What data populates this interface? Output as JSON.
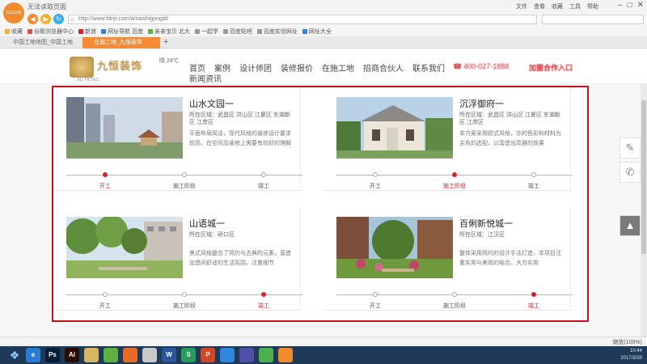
{
  "browser": {
    "logo_text": "ozzoos",
    "title": "无法读取页面",
    "title_menus": [
      "文件",
      "查看",
      "收藏",
      "工具",
      "帮助"
    ],
    "url": "http://www.fdnjr.com/a/zaishigongdi/",
    "bookmarks": [
      "收藏",
      "谷歌浏览器中心",
      "新浪",
      "网址导航 百度",
      "亲亲宝贝 北大",
      "一起学",
      "百度贴吧",
      "百度实验网址",
      "网址大全"
    ],
    "tabs": [
      "中国工地地图_中国工地",
      "在施工地_九恒装饰"
    ]
  },
  "site": {
    "name": "九恒装饰",
    "sub": "JIU HENG",
    "weather": "晴 24℃",
    "nav": [
      "首页",
      "案例",
      "设计师团",
      "装修报价",
      "在施工地",
      "招商合伙人",
      "联系我们"
    ],
    "nav_row2": "新闻资讯",
    "hotline": "400-027-1888",
    "portal": "加盟合作入口"
  },
  "projects": [
    {
      "title": "山水文园一",
      "location": "所在区域：武昌区 洪山区 江夏区 东湖新区 江岸区",
      "description": "平面布局简洁，现代风格的装修设计要求较高，在空间及装修上需要有较好的理解",
      "stages": [
        "开工",
        "施工阶段",
        "竣工"
      ],
      "current_stage": 0
    },
    {
      "title": "沉浮御府一",
      "location": "所在区域：武昌区 洪山区 江夏区 东湖新区 江岸区",
      "description": "本方案采用欧式风格，亦的色彩和材料为主色的选配，以营造出高雅的效果",
      "stages": [
        "开工",
        "施工阶段",
        "竣工"
      ],
      "current_stage": 1
    },
    {
      "title": "山语城一",
      "location": "所在区域：硚口区",
      "description": "美式风格整合了简约与古典的元素，营造出悠闲舒适的生活氛围，注重细节",
      "stages": [
        "开工",
        "施工阶段",
        "竣工"
      ],
      "current_stage": 2
    },
    {
      "title": "百俐新悦城一",
      "location": "所在区域：江汉区",
      "description": "整体采用简约的设计手法打造，本项目注重实用与美观的结合，大方实用",
      "stages": [
        "开工",
        "施工阶段",
        "竣工"
      ],
      "current_stage": 2
    }
  ],
  "float_tools": {
    "edit_icon": "✎",
    "phone_icon": "✆",
    "top_icon": "▲"
  },
  "status": {
    "zoom": "缩放(100%)"
  },
  "taskbar": {
    "apps": [
      "e",
      "Ps",
      "Ai",
      "",
      "",
      "",
      "",
      "W",
      "S",
      "P",
      "",
      "",
      "",
      ""
    ],
    "app_colors": [
      "#2a7bd4",
      "#001e36",
      "#2c0b00",
      "#d9b560",
      "#5fb043",
      "#e66b24",
      "#c9c9c9",
      "#2b579a",
      "#2a9d58",
      "#d24726",
      "#2e86de",
      "#4f4fa8",
      "#4caf50",
      "#f08a2c"
    ],
    "time": "10:44",
    "date": "2017/3/20"
  },
  "colors": {
    "accent": "#d4232b",
    "highlight_border": "#c8101e",
    "tab_active": "#f58b34"
  }
}
